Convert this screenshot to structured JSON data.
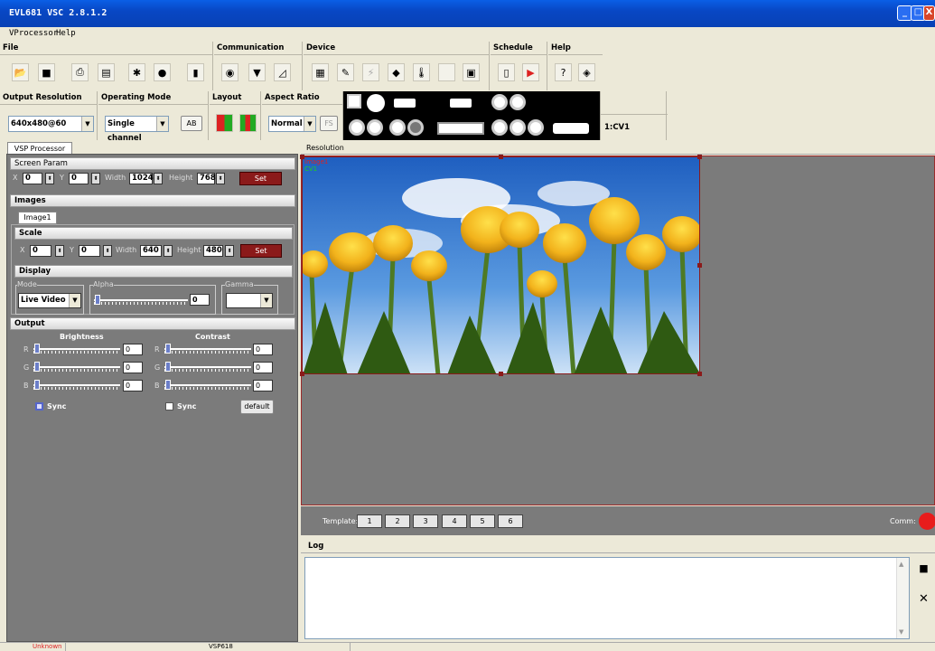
{
  "window": {
    "title": "EVL681 VSC 2.8.1.2",
    "minimize": "_",
    "maximize": "□",
    "close": "X"
  },
  "menu": [
    "VProcessor",
    "Help"
  ],
  "toolbar_groups": {
    "file": "File",
    "communication": "Communication",
    "device": "Device",
    "schedule": "Schedule",
    "help": "Help"
  },
  "settings": {
    "output_resolution_label": "Output Resolution",
    "output_resolution_value": "640x480@60",
    "operating_mode_label": "Operating Mode",
    "operating_mode_value": "Single channel",
    "ab_button": "AB",
    "layout_label": "Layout",
    "aspect_ratio_label": "Aspect Ratio",
    "aspect_ratio_value": "Normal",
    "fs_button": "FS",
    "input_indicator": "1:CV1"
  },
  "left": {
    "tab": "VSP Processor",
    "screen_param": "Screen Param",
    "x_label": "X",
    "x_value": "0",
    "y_label": "Y",
    "y_value": "0",
    "width_label": "Width",
    "width_value": "1024",
    "height_label": "Height",
    "height_value": "768",
    "set": "Set",
    "images": "Images",
    "image_tab": "Image1",
    "scale": "Scale",
    "scale_x": "0",
    "scale_y": "0",
    "scale_width": "640",
    "scale_height": "480",
    "display": "Display",
    "mode_label": "Mode",
    "mode_value": "Live Video",
    "alpha_label": "Alpha",
    "alpha_value": "0",
    "gamma_label": "Gamma",
    "output": "Output",
    "brightness": "Brightness",
    "contrast": "Contrast",
    "r": "R",
    "g": "G",
    "b": "B",
    "brightness_r": "0",
    "brightness_g": "0",
    "brightness_b": "0",
    "contrast_r": "0",
    "contrast_g": "0",
    "contrast_b": "0",
    "sync": "Sync",
    "default": "default"
  },
  "right": {
    "resolution_tab": "Resolution",
    "image_label": "Image1",
    "image_sublabel": "CV1",
    "template_label": "Template:",
    "templates": [
      "1",
      "2",
      "3",
      "4",
      "5",
      "6"
    ],
    "comm_label": "Comm:",
    "log_title": "Log"
  },
  "status": {
    "left": "Unknown",
    "device": "VSP618"
  },
  "colors": {
    "accent_red": "#8b1a1a",
    "comm_indicator": "#e81c1c",
    "title_blue": "#0a5fe6"
  }
}
